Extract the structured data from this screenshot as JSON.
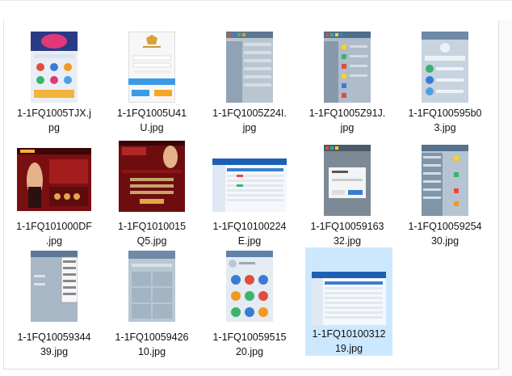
{
  "files": [
    {
      "name_line1": "1-1FQ1005TJX.j",
      "name_line2": "pg",
      "thumb": "phone-banner-icons"
    },
    {
      "name_line1": "1-1FQ1005U41",
      "name_line2": "U.jpg",
      "thumb": "phone-login"
    },
    {
      "name_line1": "1-1FQ1005Z24I.",
      "name_line2": "jpg",
      "thumb": "phone-list-gray"
    },
    {
      "name_line1": "1-1FQ1005Z91J.",
      "name_line2": "jpg",
      "thumb": "phone-list-icons"
    },
    {
      "name_line1": "1-1FQ100595b0",
      "name_line2": "3.jpg",
      "thumb": "phone-profile"
    },
    {
      "name_line1": "1-1FQ101000DF",
      "name_line2": ".jpg",
      "thumb": "casino-red-woman"
    },
    {
      "name_line1": "1-1FQ1010015",
      "name_line2": "Q5.jpg",
      "thumb": "casino-red-form"
    },
    {
      "name_line1": "1-1FQ10100224",
      "name_line2": "E.jpg",
      "thumb": "web-table-blue"
    },
    {
      "name_line1": "1-1FQ10059163",
      "name_line2": "32.jpg",
      "thumb": "phone-dialog"
    },
    {
      "name_line1": "1-1FQ10059254",
      "name_line2": "30.jpg",
      "thumb": "phone-menu-list"
    },
    {
      "name_line1": "1-1FQ10059344",
      "name_line2": "39.jpg",
      "thumb": "phone-dropdown"
    },
    {
      "name_line1": "1-1FQ10059426",
      "name_line2": "10.jpg",
      "thumb": "phone-grid"
    },
    {
      "name_line1": "1-1FQ10059515",
      "name_line2": "20.jpg",
      "thumb": "phone-app-icons"
    },
    {
      "name_line1": "1-1FQ10100312",
      "name_line2": "19.jpg",
      "thumb": "web-table-selected"
    }
  ],
  "selected_index": 13,
  "colors": {
    "selection": "#cce8ff",
    "text": "#111111"
  }
}
